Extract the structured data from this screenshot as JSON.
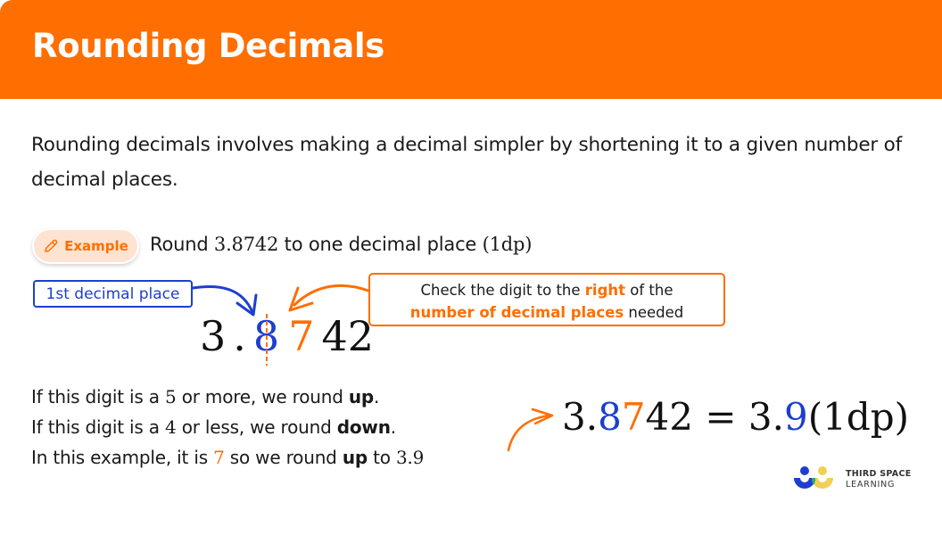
{
  "header": {
    "title": "Rounding Decimals"
  },
  "intro": {
    "text": "Rounding decimals involves making a decimal simpler by shortening it to a given number of decimal places."
  },
  "example": {
    "badge_label": "Example",
    "badge_icon": "pencil-icon",
    "question_prefix": "Round ",
    "question_number": "3.8742",
    "question_suffix": " to one decimal place ",
    "question_dp": "(1dp)"
  },
  "annotation": {
    "label": "1st decimal place",
    "callout_line1_pre": "Check the digit to the ",
    "callout_line1_hl": "right",
    "callout_line1_post": " of the",
    "callout_line2_hl": "number of decimal places",
    "callout_line2_post": " needed"
  },
  "big_number": {
    "digits": [
      "3",
      ".",
      "8",
      "7",
      "4",
      "2"
    ]
  },
  "rules": {
    "line1_pre": "If this digit is a ",
    "line1_num": "5",
    "line1_mid": " or more, we round ",
    "line1_bold": "up",
    "line1_end": ".",
    "line2_pre": "If this digit is a ",
    "line2_num": "4",
    "line2_mid": " or less, we round ",
    "line2_bold": "down",
    "line2_end": ".",
    "line3_pre": "In this example, it is ",
    "line3_num": "7",
    "line3_mid": " so we round ",
    "line3_bold": "up",
    "line3_post": " to ",
    "line3_result": "3.9"
  },
  "result": {
    "int": "3.",
    "d1": "8",
    "d2": "7",
    "rest": "42",
    "equals": " = ",
    "r_int": "3.",
    "r_d1": "9",
    "r_dp": "(1dp)"
  },
  "logo": {
    "line1": "THIRD SPACE",
    "line2": "LEARNING"
  },
  "colors": {
    "brand_orange": "#ff6e00",
    "accent_blue": "#1d3fcf",
    "badge_bg": "#ffe3d1"
  }
}
